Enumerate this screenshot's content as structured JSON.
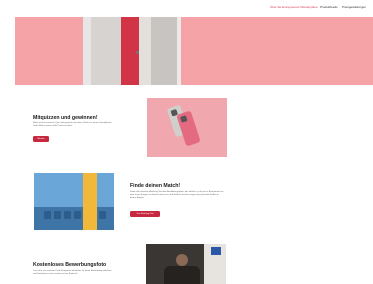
{
  "nav": {
    "items": [
      {
        "label": "Über die Entrepreneur Meisterplane",
        "active": true
      },
      {
        "label": "Produktfeeds",
        "active": false
      },
      {
        "label": "Preisgestaltungen",
        "active": false
      }
    ]
  },
  "sections": {
    "quiz": {
      "title": "Mitquizzen und gewinnen!",
      "text": "Mach mit bei unserem Quiz und gewinne mit etwas Glück ein neues Smartphone. Jede Woche warten tolle Preise auf dich.",
      "button": "Mitraten"
    },
    "match": {
      "title": "Finde deinen Match!",
      "text": "Finde mit unserem Matching-Tool den Ausbildungsplatz, der wirklich zu dir passt. Beantworte ein paar kurze Fragen zu deinen Interessen und Stärken und wir zeigen dir passende Stellen in deiner Region.",
      "button": "Zum Matching-Tool"
    },
    "photo": {
      "title": "Kostenloses Bewerbungsfoto",
      "text": "Lass dich von unseren Profi-Fotografen kostenlos für deine Bewerbung ablichten und hinterlasse einen starken ersten Eindruck."
    }
  },
  "icons": [
    "phone-image",
    "waiting-room-image",
    "photographer-image"
  ],
  "colors": {
    "accent": "#c8283f",
    "hero_bg": "#f5a3a7",
    "nav_active": "#d9385a"
  }
}
